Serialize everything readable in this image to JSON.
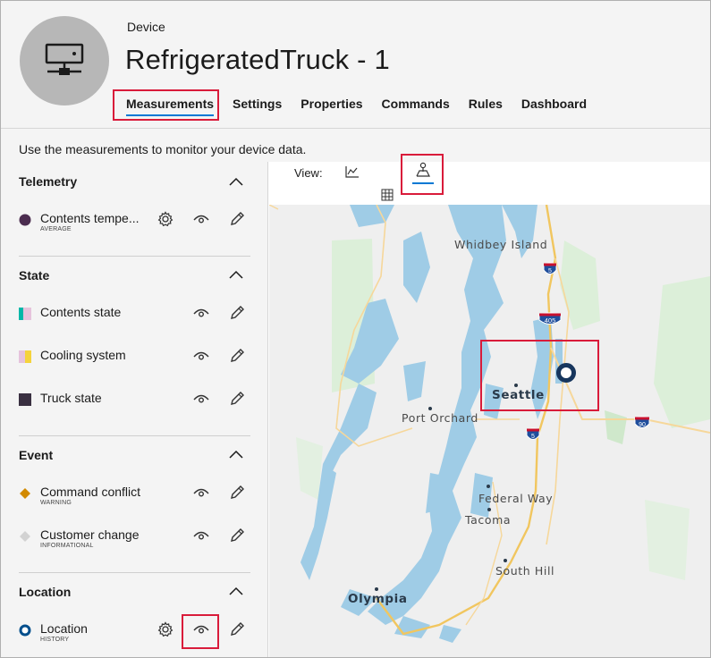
{
  "header": {
    "device_type": "Device",
    "device_name": "RefrigeratedTruck - 1",
    "tabs": [
      {
        "label": "Measurements",
        "active": true
      },
      {
        "label": "Settings",
        "active": false
      },
      {
        "label": "Properties",
        "active": false
      },
      {
        "label": "Commands",
        "active": false
      },
      {
        "label": "Rules",
        "active": false
      },
      {
        "label": "Dashboard",
        "active": false
      }
    ],
    "description": "Use the measurements to monitor your device data."
  },
  "sections": {
    "telemetry": {
      "title": "Telemetry",
      "items": [
        {
          "label": "Contents tempe...",
          "sub": "AVERAGE",
          "color": "#4b2c4f",
          "swatch": "circle",
          "has_settings": true
        }
      ]
    },
    "state": {
      "title": "State",
      "items": [
        {
          "label": "Contents state",
          "colors": [
            "#00b7a8",
            "#e6c3dc"
          ],
          "swatch": "split"
        },
        {
          "label": "Cooling system",
          "colors": [
            "#e6c3dc",
            "#f5d33c"
          ],
          "swatch": "split"
        },
        {
          "label": "Truck state",
          "colors": [
            "#3a3041"
          ],
          "swatch": "square"
        }
      ]
    },
    "event": {
      "title": "Event",
      "items": [
        {
          "label": "Command conflict",
          "sub": "WARNING",
          "color": "#d28a00",
          "swatch": "diamond"
        },
        {
          "label": "Customer change",
          "sub": "INFORMATIONAL",
          "color": "#d2d2d2",
          "swatch": "diamond"
        }
      ]
    },
    "location": {
      "title": "Location",
      "items": [
        {
          "label": "Location",
          "sub": "HISTORY",
          "color": "#004e8c",
          "swatch": "ring",
          "has_settings": true
        }
      ]
    }
  },
  "view": {
    "label": "View:",
    "options": [
      {
        "icon": "line-chart-icon",
        "active": false
      },
      {
        "icon": "map-icon",
        "active": true
      },
      {
        "icon": "grid-icon",
        "active": false
      }
    ]
  },
  "map": {
    "labels": {
      "whidbey": "Whidbey Island",
      "seattle": "Seattle",
      "port_orchard": "Port Orchard",
      "federal_way": "Federal Way",
      "tacoma": "Tacoma",
      "south_hill": "South Hill",
      "olympia": "Olympia"
    },
    "shields": {
      "i5_north": "5",
      "i405": "405",
      "i5_south": "5",
      "i90": "90"
    }
  },
  "colors": {
    "accent": "#0078d4",
    "highlight": "#d91b3a",
    "water": "#9fcce6",
    "land": "#efefef",
    "park": "#d5ecd3",
    "road": "#f1c65f"
  }
}
